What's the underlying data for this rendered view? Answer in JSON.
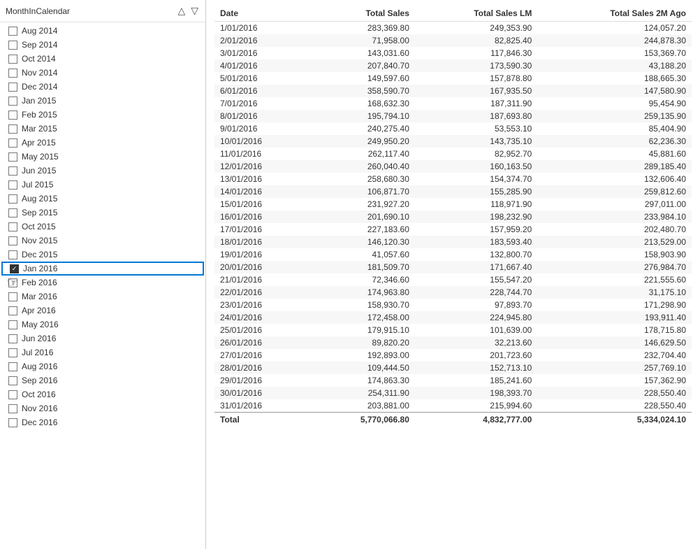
{
  "leftPanel": {
    "header": {
      "title": "MonthInCalendar",
      "sortAscIcon": "△",
      "sortDescIcon": "▽"
    },
    "items": [
      {
        "label": "Aug 2014",
        "checked": false
      },
      {
        "label": "Sep 2014",
        "checked": false
      },
      {
        "label": "Oct 2014",
        "checked": false
      },
      {
        "label": "Nov 2014",
        "checked": false
      },
      {
        "label": "Dec 2014",
        "checked": false
      },
      {
        "label": "Jan 2015",
        "checked": false
      },
      {
        "label": "Feb 2015",
        "checked": false
      },
      {
        "label": "Mar 2015",
        "checked": false
      },
      {
        "label": "Apr 2015",
        "checked": false
      },
      {
        "label": "May 2015",
        "checked": false
      },
      {
        "label": "Jun 2015",
        "checked": false
      },
      {
        "label": "Jul 2015",
        "checked": false
      },
      {
        "label": "Aug 2015",
        "checked": false
      },
      {
        "label": "Sep 2015",
        "checked": false
      },
      {
        "label": "Oct 2015",
        "checked": false
      },
      {
        "label": "Nov 2015",
        "checked": false
      },
      {
        "label": "Dec 2015",
        "checked": false
      },
      {
        "label": "Jan 2016",
        "checked": true,
        "selected": true
      },
      {
        "label": "Feb 2016",
        "checked": false
      },
      {
        "label": "Mar 2016",
        "checked": false
      },
      {
        "label": "Apr 2016",
        "checked": false
      },
      {
        "label": "May 2016",
        "checked": false
      },
      {
        "label": "Jun 2016",
        "checked": false
      },
      {
        "label": "Jul 2016",
        "checked": false
      },
      {
        "label": "Aug 2016",
        "checked": false
      },
      {
        "label": "Sep 2016",
        "checked": false
      },
      {
        "label": "Oct 2016",
        "checked": false
      },
      {
        "label": "Nov 2016",
        "checked": false
      },
      {
        "label": "Dec 2016",
        "checked": false
      }
    ]
  },
  "table": {
    "columns": [
      "Date",
      "Total Sales",
      "Total Sales LM",
      "Total Sales 2M Ago"
    ],
    "rows": [
      [
        "1/01/2016",
        "283,369.80",
        "249,353.90",
        "124,057.20"
      ],
      [
        "2/01/2016",
        "71,958.00",
        "82,825.40",
        "244,878.30"
      ],
      [
        "3/01/2016",
        "143,031.60",
        "117,846.30",
        "153,369.70"
      ],
      [
        "4/01/2016",
        "207,840.70",
        "173,590.30",
        "43,188.20"
      ],
      [
        "5/01/2016",
        "149,597.60",
        "157,878.80",
        "188,665.30"
      ],
      [
        "6/01/2016",
        "358,590.70",
        "167,935.50",
        "147,580.90"
      ],
      [
        "7/01/2016",
        "168,632.30",
        "187,311.90",
        "95,454.90"
      ],
      [
        "8/01/2016",
        "195,794.10",
        "187,693.80",
        "259,135.90"
      ],
      [
        "9/01/2016",
        "240,275.40",
        "53,553.10",
        "85,404.90"
      ],
      [
        "10/01/2016",
        "249,950.20",
        "143,735.10",
        "62,236.30"
      ],
      [
        "11/01/2016",
        "262,117.40",
        "82,952.70",
        "45,881.60"
      ],
      [
        "12/01/2016",
        "260,040.40",
        "160,163.50",
        "289,185.40"
      ],
      [
        "13/01/2016",
        "258,680.30",
        "154,374.70",
        "132,606.40"
      ],
      [
        "14/01/2016",
        "106,871.70",
        "155,285.90",
        "259,812.60"
      ],
      [
        "15/01/2016",
        "231,927.20",
        "118,971.90",
        "297,011.00"
      ],
      [
        "16/01/2016",
        "201,690.10",
        "198,232.90",
        "233,984.10"
      ],
      [
        "17/01/2016",
        "227,183.60",
        "157,959.20",
        "202,480.70"
      ],
      [
        "18/01/2016",
        "146,120.30",
        "183,593.40",
        "213,529.00"
      ],
      [
        "19/01/2016",
        "41,057.60",
        "132,800.70",
        "158,903.90"
      ],
      [
        "20/01/2016",
        "181,509.70",
        "171,667.40",
        "276,984.70"
      ],
      [
        "21/01/2016",
        "72,346.60",
        "155,547.20",
        "221,555.60"
      ],
      [
        "22/01/2016",
        "174,963.80",
        "228,744.70",
        "31,175.10"
      ],
      [
        "23/01/2016",
        "158,930.70",
        "97,893.70",
        "171,298.90"
      ],
      [
        "24/01/2016",
        "172,458.00",
        "224,945.80",
        "193,911.40"
      ],
      [
        "25/01/2016",
        "179,915.10",
        "101,639.00",
        "178,715.80"
      ],
      [
        "26/01/2016",
        "89,820.20",
        "32,213.60",
        "146,629.50"
      ],
      [
        "27/01/2016",
        "192,893.00",
        "201,723.60",
        "232,704.40"
      ],
      [
        "28/01/2016",
        "109,444.50",
        "152,713.10",
        "257,769.10"
      ],
      [
        "29/01/2016",
        "174,863.30",
        "185,241.60",
        "157,362.90"
      ],
      [
        "30/01/2016",
        "254,311.90",
        "198,393.70",
        "228,550.40"
      ],
      [
        "31/01/2016",
        "203,881.00",
        "215,994.60",
        "228,550.40"
      ]
    ],
    "footer": {
      "label": "Total",
      "totalSales": "5,770,066.80",
      "totalSalesLM": "4,832,777.00",
      "totalSales2MAgo": "5,334,024.10"
    }
  }
}
